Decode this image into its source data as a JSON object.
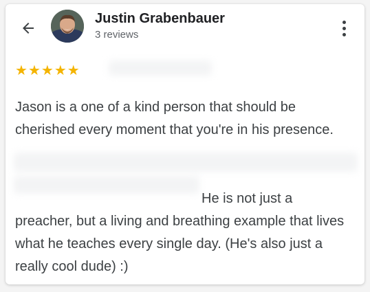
{
  "reviewer": {
    "name": "Justin Grabenbauer",
    "review_count": "3 reviews"
  },
  "review": {
    "rating": 5,
    "max_rating": 5,
    "paragraph1": "Jason is a one of a kind person that should be cherished every moment that you're in his presence.",
    "paragraph2_line1": "He is not just a",
    "paragraph2_rest": "preacher, but a living and breathing example that lives what he teaches every single day. (He's also just a really cool dude) :)"
  },
  "icons": {
    "back": "arrow-back-icon",
    "more": "more-vert-icon",
    "star": "star-icon"
  },
  "colors": {
    "star": "#f4b400",
    "name": "#202124",
    "secondary_text": "#5f6368",
    "body_text": "#3c4043"
  }
}
